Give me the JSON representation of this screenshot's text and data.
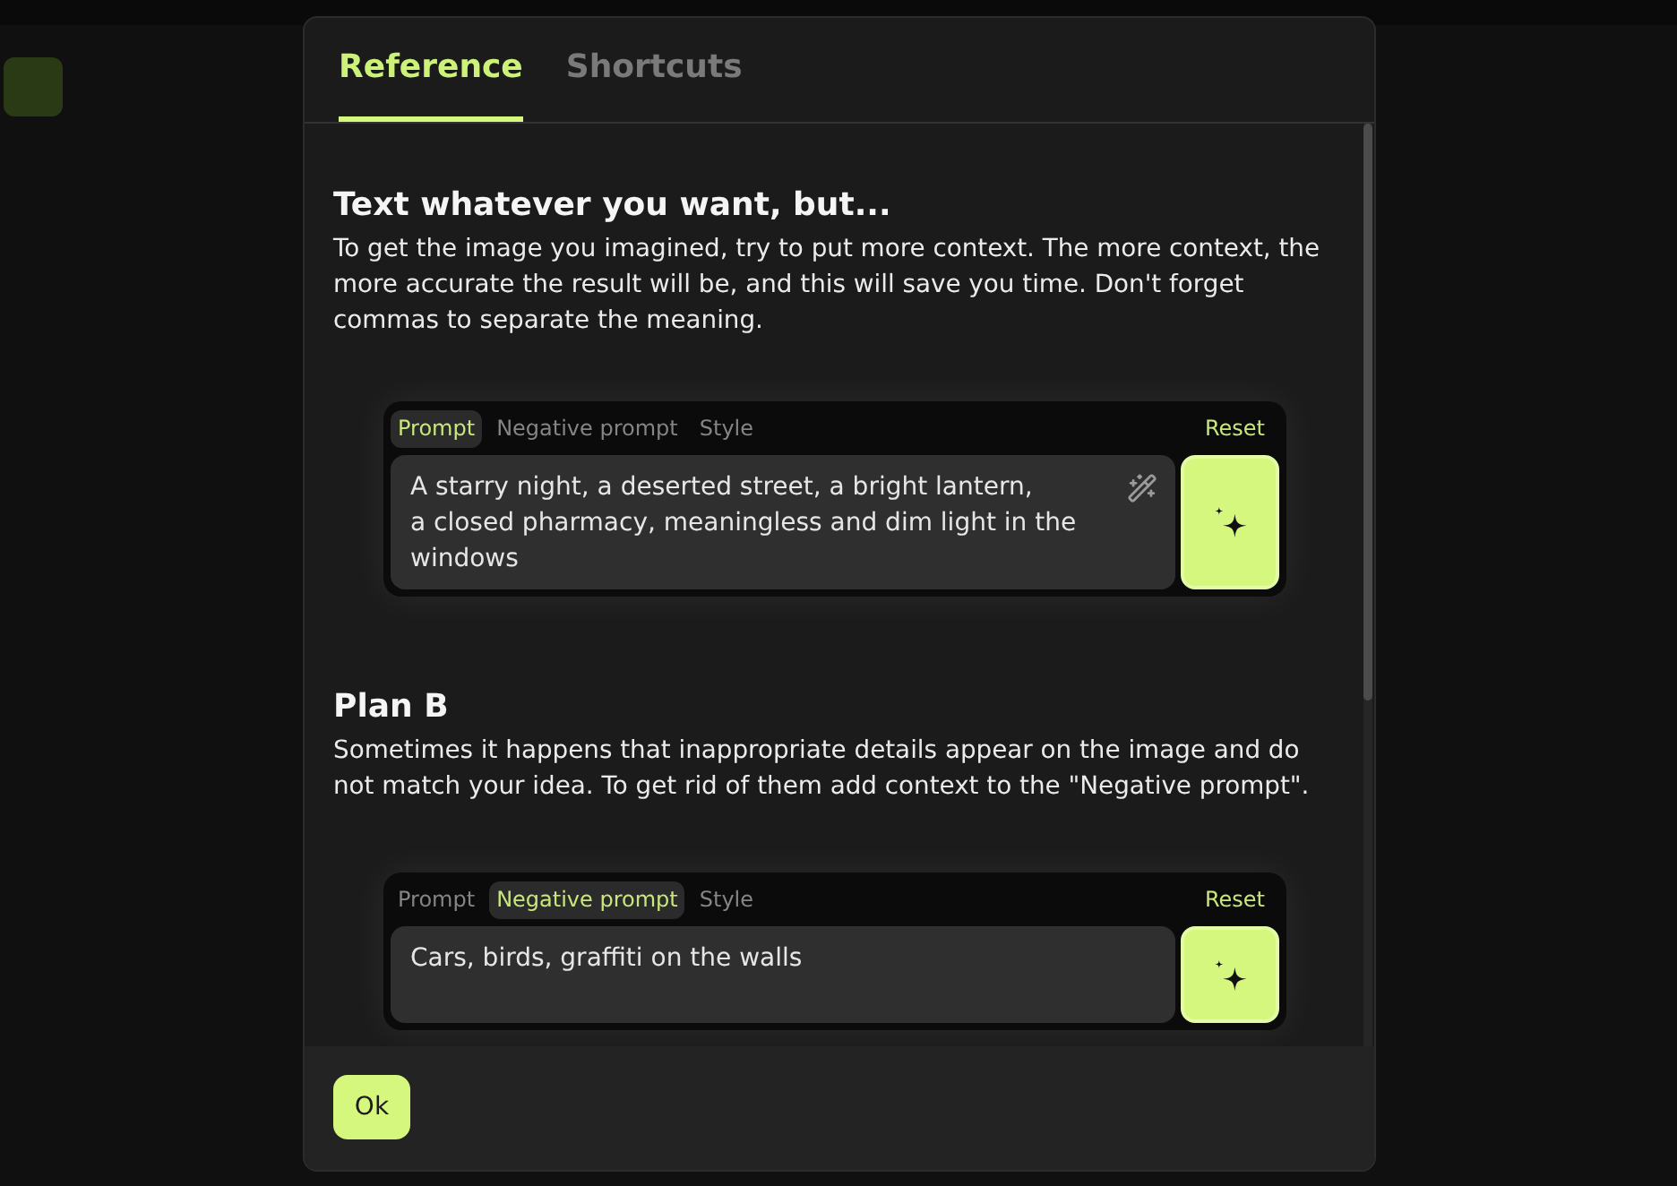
{
  "dialog": {
    "tabs": [
      {
        "label": "Reference",
        "selected": true
      },
      {
        "label": "Shortcuts",
        "selected": false
      }
    ],
    "sections": [
      {
        "title": "Text whatever you want, but...",
        "text": "To get the image you imagined, try to put more context. The more context, the more accurate the result will be, and this will save you time. Don't forget commas to separate the meaning.",
        "example": {
          "tabs": [
            {
              "label": "Prompt",
              "selected": true
            },
            {
              "label": "Negative prompt",
              "selected": false
            },
            {
              "label": "Style",
              "selected": false
            }
          ],
          "reset": "Reset",
          "value": "A starry night, a deserted street, a bright lantern,\na closed pharmacy, meaningless and dim light in the windows",
          "enhance_icon": true
        }
      },
      {
        "title": "Plan B",
        "text": "Sometimes it happens that inappropriate details appear on the image and do not match your idea. To get rid of them add context to the \"Negative prompt\".",
        "example": {
          "tabs": [
            {
              "label": "Prompt",
              "selected": false
            },
            {
              "label": "Negative prompt",
              "selected": true
            },
            {
              "label": "Style",
              "selected": false
            }
          ],
          "reset": "Reset",
          "value": "Cars, birds, graffiti on the walls",
          "enhance_icon": false
        }
      }
    ],
    "ok_button": "Ok"
  }
}
